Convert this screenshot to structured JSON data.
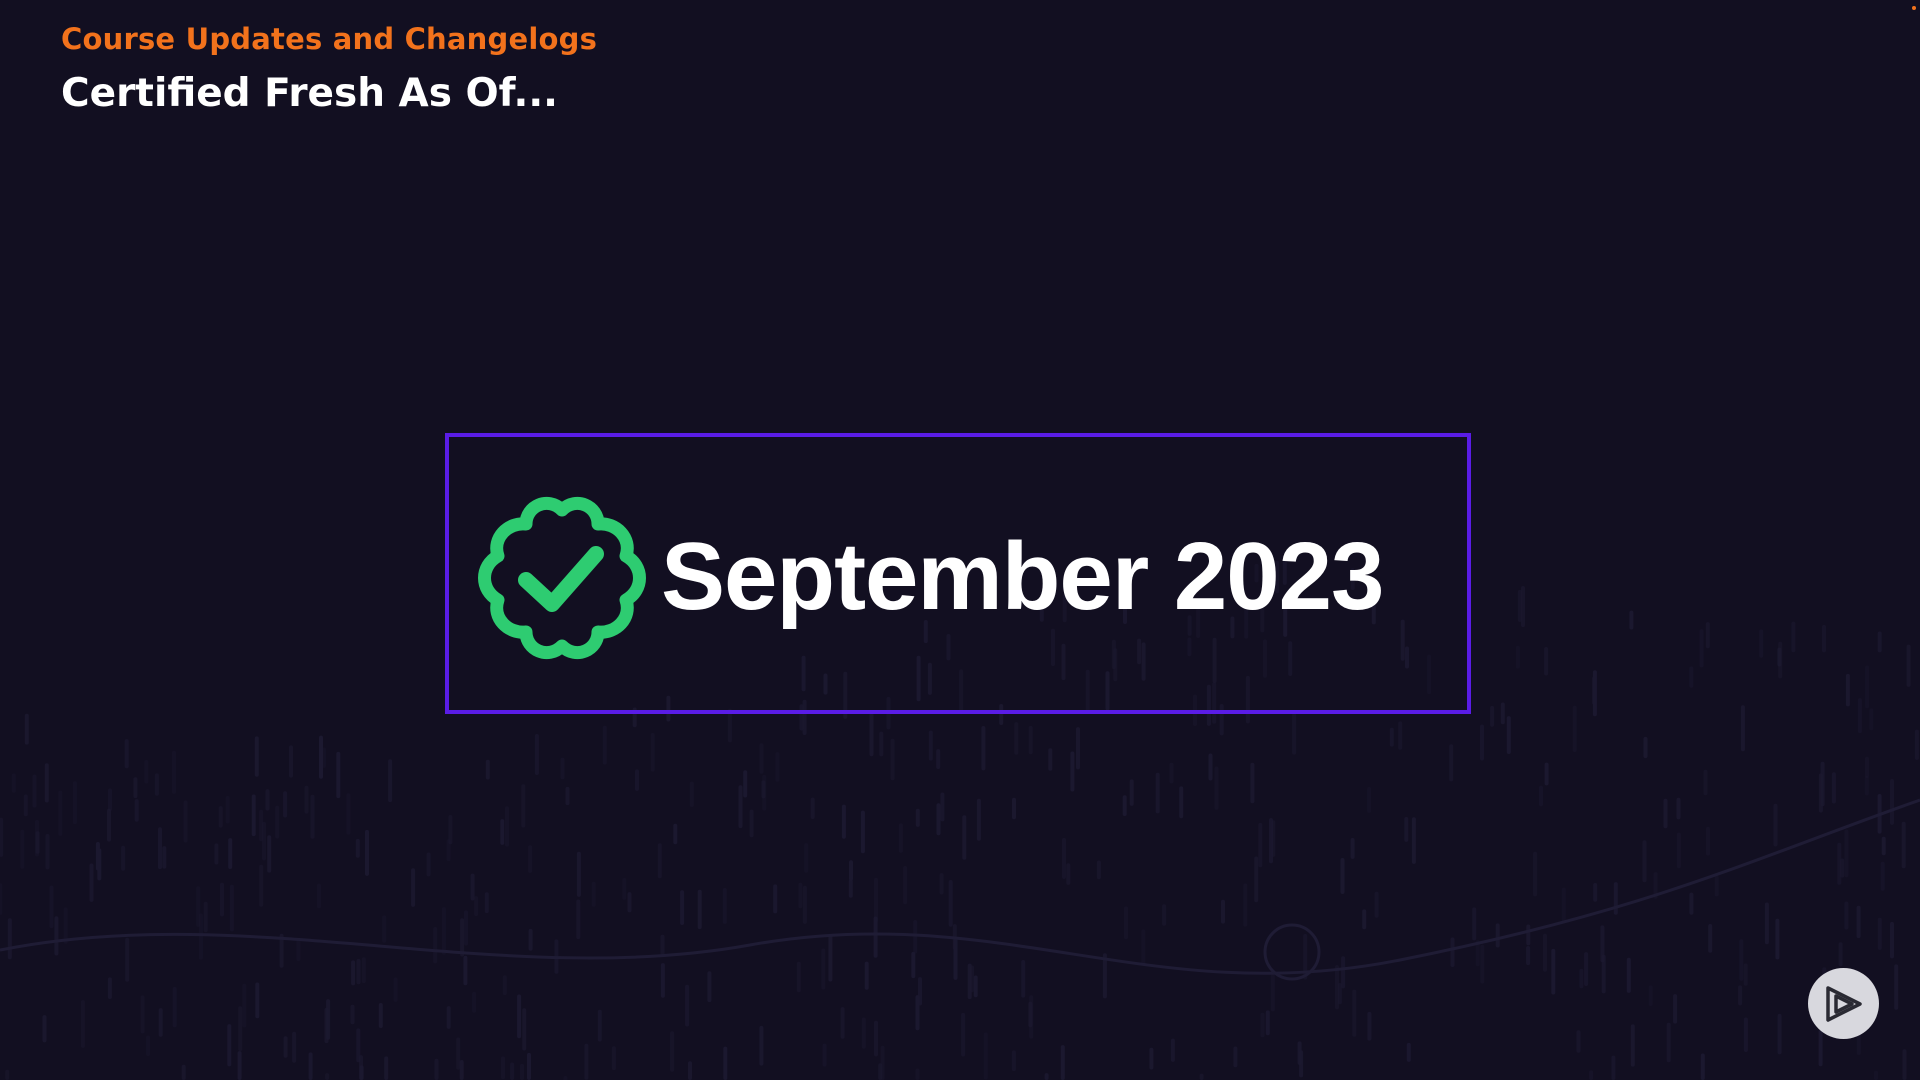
{
  "header": {
    "eyebrow": "Course Updates and Changelogs",
    "title": "Certified Fresh As Of..."
  },
  "card": {
    "date": "September 2023",
    "icon": "verified-badge-icon"
  },
  "controls": {
    "play_icon": "play-logo-icon"
  },
  "colors": {
    "background": "#120f21",
    "accent": "#f2721c",
    "card_border": "#5a1ce6",
    "badge": "#2ecc71",
    "text": "#ffffff"
  }
}
